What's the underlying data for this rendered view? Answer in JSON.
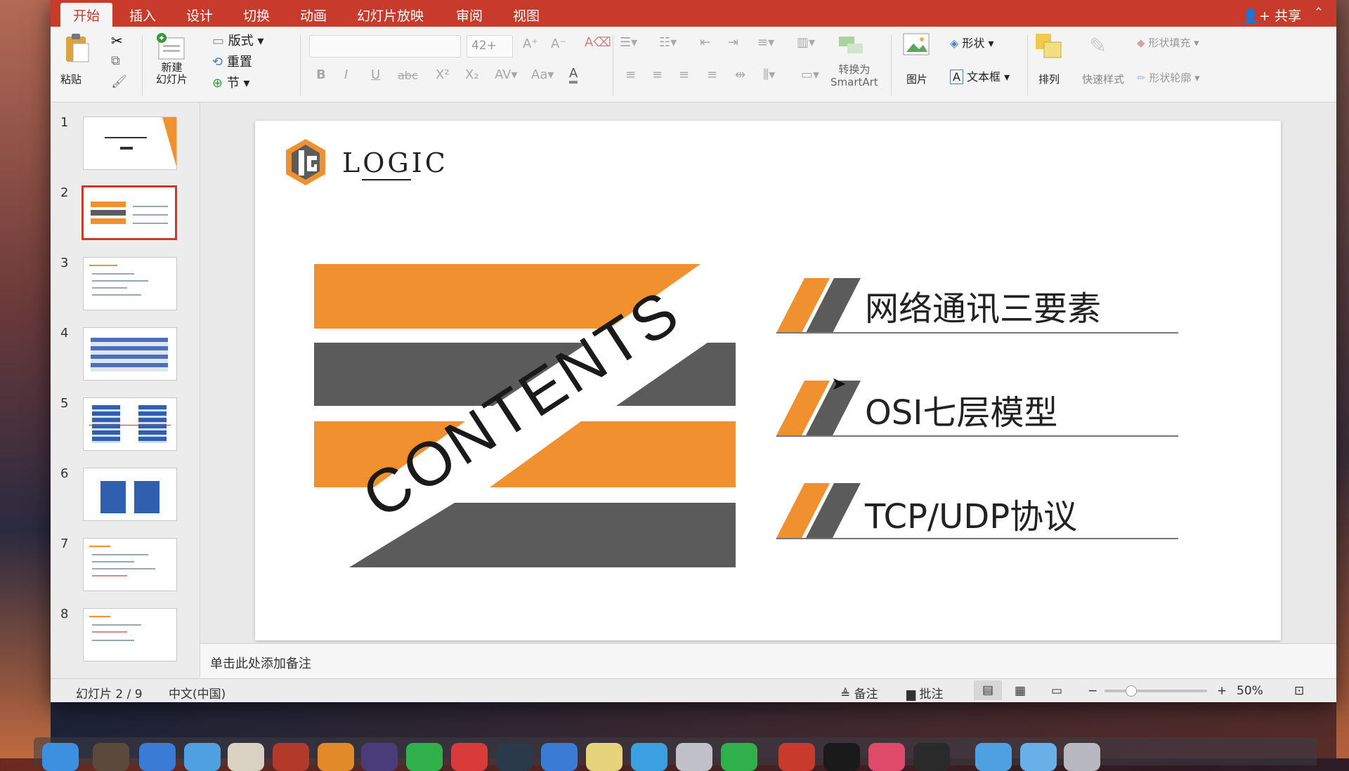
{
  "tabs": [
    {
      "label": "开始",
      "active": true
    },
    {
      "label": "插入"
    },
    {
      "label": "设计"
    },
    {
      "label": "切换"
    },
    {
      "label": "动画"
    },
    {
      "label": "幻灯片放映"
    },
    {
      "label": "审阅"
    },
    {
      "label": "视图"
    }
  ],
  "header": {
    "share_label": "共享"
  },
  "ribbon": {
    "paste_label": "粘贴",
    "new_slide_label": "新建\n幻灯片",
    "layout_label": "版式",
    "reset_label": "重置",
    "section_label": "节",
    "font_size": "42+",
    "convert_smartart_line1": "转换为",
    "convert_smartart_line2": "SmartArt",
    "picture_label": "图片",
    "shape_label": "形状",
    "textbox_label": "文本框",
    "arrange_label": "排列",
    "quick_styles_label": "快速样式",
    "shape_fill_label": "形状填充",
    "shape_outline_label": "形状轮廓",
    "bold": "B",
    "italic": "I",
    "underline": "U",
    "strike": "abc"
  },
  "thumbnails": [
    {
      "num": "1"
    },
    {
      "num": "2",
      "selected": true
    },
    {
      "num": "3"
    },
    {
      "num": "4"
    },
    {
      "num": "5"
    },
    {
      "num": "6"
    },
    {
      "num": "7"
    },
    {
      "num": "8"
    }
  ],
  "slide": {
    "logo_text": "LOGIC",
    "contents_text": "CONTENTS",
    "items": [
      {
        "text": "网络通讯三要素"
      },
      {
        "text": "OSI七层模型"
      },
      {
        "text": "TCP/UDP协议"
      }
    ]
  },
  "notes": {
    "placeholder": "单击此处添加备注"
  },
  "status": {
    "slide_counter": "幻灯片 2 / 9",
    "language": "中文(中国)",
    "notes_label": "备注",
    "comments_label": "批注",
    "zoom": "50%"
  },
  "colors": {
    "accent": "#c73a2c",
    "orange": "#f0902e",
    "gray": "#5b5b5b"
  }
}
